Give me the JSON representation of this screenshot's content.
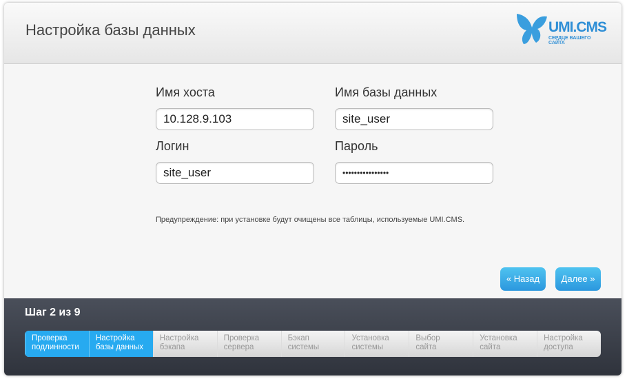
{
  "header": {
    "title": "Настройка базы данных",
    "logo_brand": "UMI.CMS",
    "logo_tagline": "СЕРДЦЕ ВАШЕГО САЙТА"
  },
  "form": {
    "host_label": "Имя хоста",
    "host_value": "10.128.9.103",
    "db_label": "Имя базы данных",
    "db_value": "site_user",
    "login_label": "Логин",
    "login_value": "site_user",
    "password_label": "Пароль",
    "password_value": "••••••••••••••••"
  },
  "warning": "Предупреждение: при установке будут очищены все таблицы, используемые UMI.CMS.",
  "buttons": {
    "back": "«  Назад",
    "next": "Далее  »"
  },
  "footer": {
    "step_text": "Шаг 2 из 9",
    "steps": [
      {
        "line1": "Проверка",
        "line2": "подлинности",
        "done": true
      },
      {
        "line1": "Настройка",
        "line2": "базы данных",
        "done": true
      },
      {
        "line1": "Настройка",
        "line2": "бэкапа"
      },
      {
        "line1": "Проверка",
        "line2": "сервера"
      },
      {
        "line1": "Бэкап",
        "line2": "системы"
      },
      {
        "line1": "Установка",
        "line2": "системы"
      },
      {
        "line1": "Выбор",
        "line2": "сайта"
      },
      {
        "line1": "Установка",
        "line2": "сайта"
      },
      {
        "line1": "Настройка",
        "line2": "доступа"
      }
    ]
  },
  "colors": {
    "accent": "#27aaf0",
    "footer": "#3b3f48"
  }
}
